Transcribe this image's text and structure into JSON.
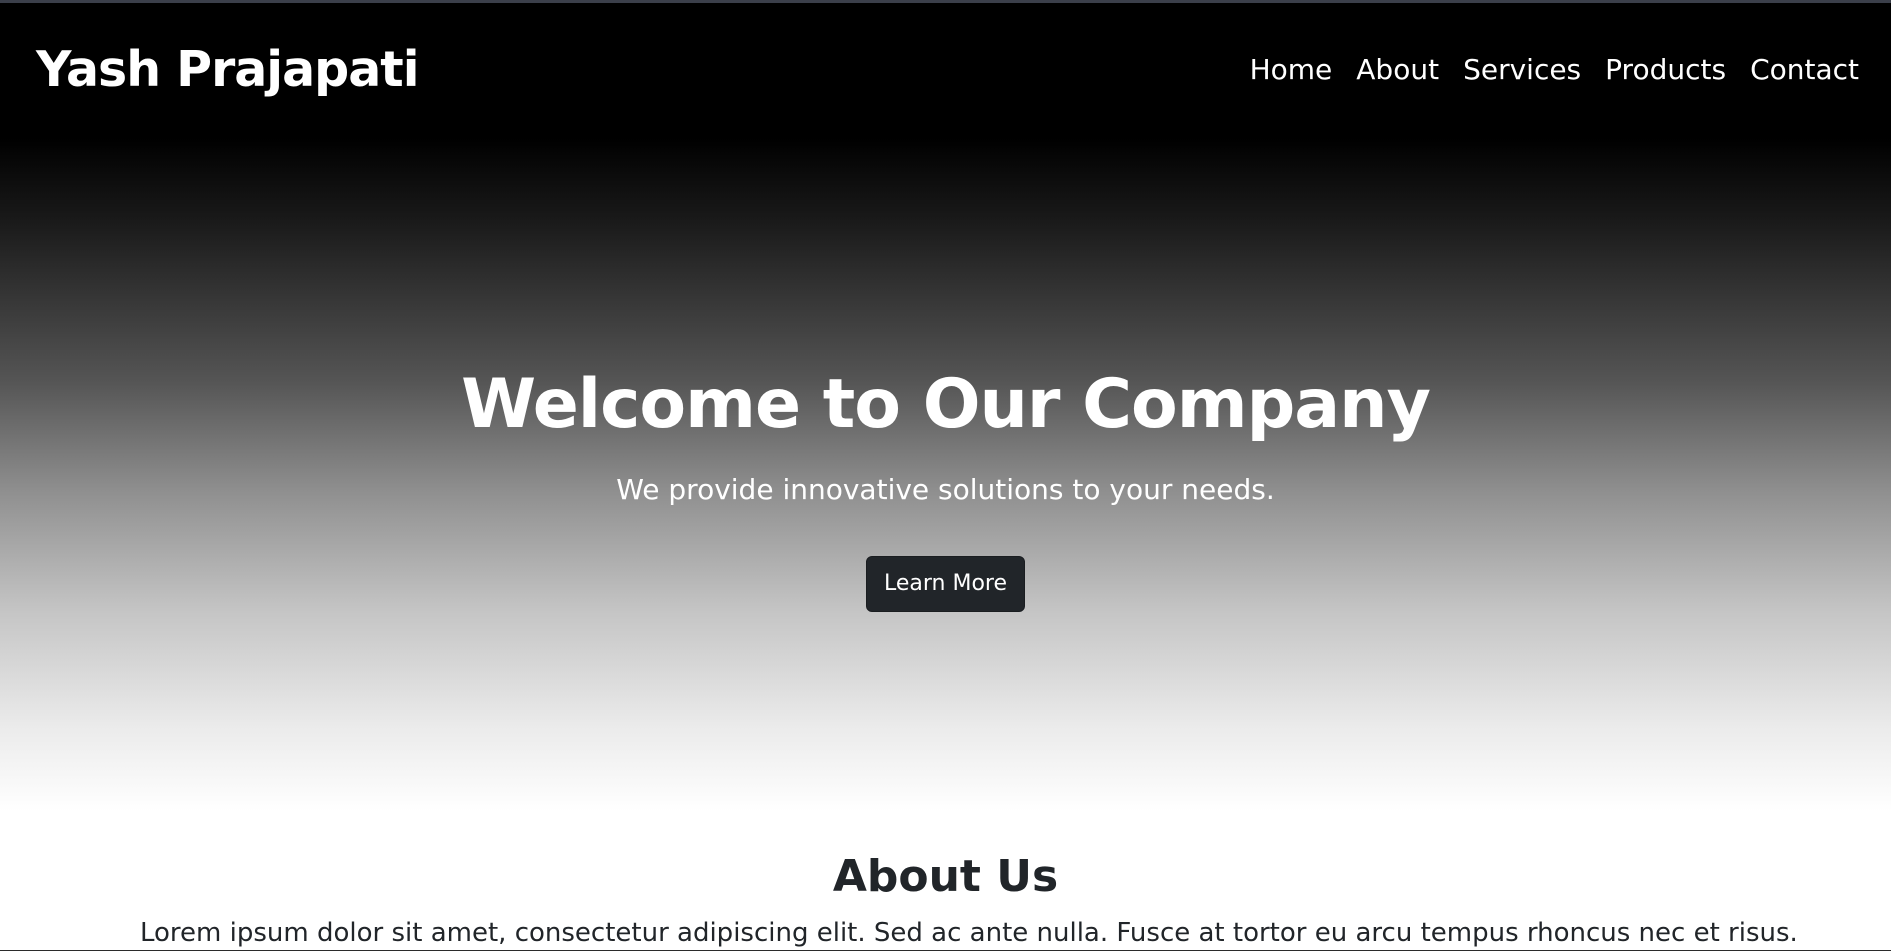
{
  "navbar": {
    "brand": "Yash Prajapati",
    "links": [
      "Home",
      "About",
      "Services",
      "Products",
      "Contact"
    ]
  },
  "hero": {
    "title": "Welcome to Our Company",
    "subtitle": "We provide innovative solutions to your needs.",
    "button_label": "Learn More"
  },
  "about": {
    "title": "About Us",
    "text": "Lorem ipsum dolor sit amet, consectetur adipiscing elit. Sed ac ante nulla. Fusce at tortor eu arcu tempus rhoncus nec et risus."
  },
  "colors": {
    "hero_gradient_top": "#000000",
    "hero_gradient_bottom": "#ffffff",
    "button_bg": "#212529",
    "text_dark": "#212529"
  }
}
